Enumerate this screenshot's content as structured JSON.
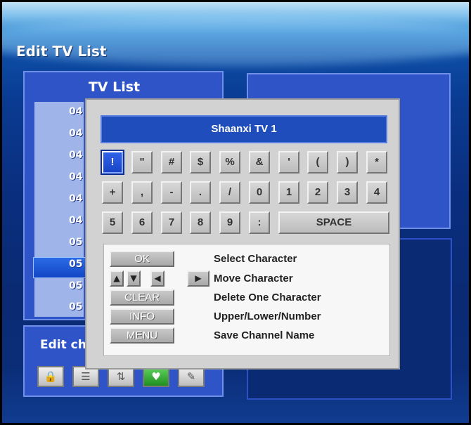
{
  "page": {
    "title": "Edit TV List"
  },
  "tv_list": {
    "title": "TV List",
    "items": [
      "04",
      "04",
      "04",
      "04",
      "04",
      "04",
      "05",
      "05",
      "05",
      "05"
    ],
    "selected_index": 4
  },
  "right_panel": {
    "text": ""
  },
  "edit_panel": {
    "label": "Edit ch",
    "icons": [
      "lock-icon",
      "skip-icon",
      "move-icon",
      "favorite-icon",
      "rename-icon"
    ]
  },
  "dialog": {
    "name_value": "Shaanxi TV 1",
    "keys_row1": [
      "!",
      "\"",
      "#",
      "$",
      "%",
      "&",
      "'",
      "(",
      ")",
      "*"
    ],
    "keys_row2": [
      "+",
      ",",
      "-",
      ".",
      "/",
      "0",
      "1",
      "2",
      "3",
      "4"
    ],
    "keys_row3": [
      "5",
      "6",
      "7",
      "8",
      "9",
      ":"
    ],
    "space_label": "SPACE",
    "selected_key": "!",
    "help": [
      {
        "button": "OK",
        "desc": "Select Character"
      },
      {
        "button": "",
        "desc": "Move Character"
      },
      {
        "button": "CLEAR",
        "desc": "Delete One Character"
      },
      {
        "button": "INFO",
        "desc": "Upper/Lower/Number"
      },
      {
        "button": "MENU",
        "desc": "Save Channel Name"
      }
    ],
    "arrow_icons": [
      "up-arrow-icon",
      "down-arrow-icon",
      "left-arrow-icon",
      "right-arrow-icon"
    ]
  }
}
